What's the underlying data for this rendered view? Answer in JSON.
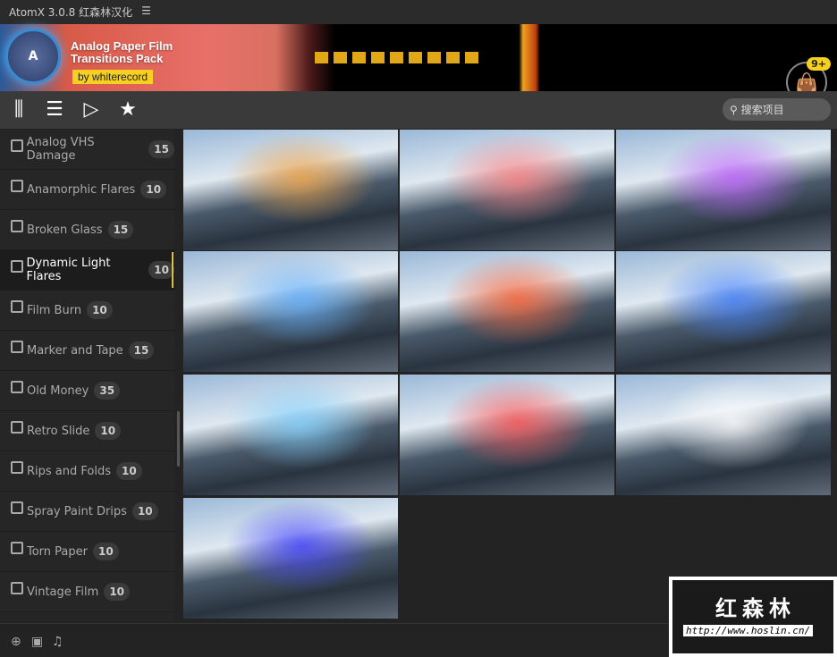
{
  "app": {
    "title": "AtomX 3.0.8 红森林汉化",
    "menu_icon": "menu-icon"
  },
  "banner": {
    "title_line1": "Analog Paper Film",
    "title_line2": "Transitions Pack",
    "author": "by whiterecord",
    "logo_letter": "A",
    "cart_badge": "9+"
  },
  "toolbar": {
    "search_placeholder": "搜索项目"
  },
  "sidebar": {
    "items": [
      {
        "label": "Analog VHS Damage",
        "count": "15"
      },
      {
        "label": "Anamorphic Flares",
        "count": "10"
      },
      {
        "label": "Broken Glass",
        "count": "15"
      },
      {
        "label": "Dynamic Light Flares",
        "count": "10",
        "active": true
      },
      {
        "label": "Film Burn",
        "count": "10"
      },
      {
        "label": "Marker and Tape",
        "count": "15"
      },
      {
        "label": "Old Money",
        "count": "35"
      },
      {
        "label": "Retro Slide",
        "count": "10"
      },
      {
        "label": "Rips and Folds",
        "count": "10"
      },
      {
        "label": "Spray Paint Drips",
        "count": "10"
      },
      {
        "label": "Torn Paper",
        "count": "10"
      },
      {
        "label": "Vintage Film",
        "count": "10"
      }
    ]
  },
  "thumbnails": [
    {
      "accent": "#f0a040"
    },
    {
      "accent": "#ff8080"
    },
    {
      "accent": "#c060ff"
    },
    {
      "accent": "#60b0ff"
    },
    {
      "accent": "#ff6030"
    },
    {
      "accent": "#4080ff"
    },
    {
      "accent": "#80d0ff"
    },
    {
      "accent": "#ff5050"
    },
    {
      "accent": "#ffffff"
    },
    {
      "accent": "#4040ff"
    }
  ],
  "watermark": {
    "text": "红森林",
    "url": "http://www.hoslin.cn/"
  }
}
